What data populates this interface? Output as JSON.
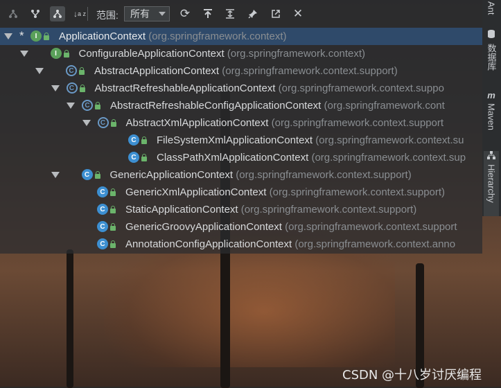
{
  "toolbar": {
    "scope_label": "范围:",
    "scope_value": "所有",
    "icons": [
      "supertype-hierarchy-icon",
      "subtype-hierarchy-icon",
      "class-hierarchy-icon",
      "sort-alpha-icon",
      "refresh-icon",
      "export-icon",
      "expand-all-icon",
      "pin-icon",
      "open-in-new-icon",
      "close-icon"
    ]
  },
  "tree": [
    {
      "name": "ApplicationContext",
      "pkg": "(org.springframework.context)",
      "kind": "interface",
      "star": "*",
      "selected": true
    },
    {
      "name": "ConfigurableApplicationContext",
      "pkg": "(org.springframework.context)",
      "kind": "interface"
    },
    {
      "name": "AbstractApplicationContext",
      "pkg": "(org.springframework.context.support)",
      "kind": "abstract"
    },
    {
      "name": "AbstractRefreshableApplicationContext",
      "pkg": "(org.springframework.context.suppo",
      "kind": "abstract"
    },
    {
      "name": "AbstractRefreshableConfigApplicationContext",
      "pkg": "(org.springframework.cont",
      "kind": "abstract"
    },
    {
      "name": "AbstractXmlApplicationContext",
      "pkg": "(org.springframework.context.support",
      "kind": "abstract"
    },
    {
      "name": "FileSystemXmlApplicationContext",
      "pkg": "(org.springframework.context.su",
      "kind": "class"
    },
    {
      "name": "ClassPathXmlApplicationContext",
      "pkg": "(org.springframework.context.sup",
      "kind": "class"
    },
    {
      "name": "GenericApplicationContext",
      "pkg": "(org.springframework.context.support)",
      "kind": "class"
    },
    {
      "name": "GenericXmlApplicationContext",
      "pkg": "(org.springframework.context.support)",
      "kind": "class"
    },
    {
      "name": "StaticApplicationContext",
      "pkg": "(org.springframework.context.support)",
      "kind": "class"
    },
    {
      "name": "GenericGroovyApplicationContext",
      "pkg": "(org.springframework.context.support",
      "kind": "class"
    },
    {
      "name": "AnnotationConfigApplicationContext",
      "pkg": "(org.springframework.context.anno",
      "kind": "class"
    }
  ],
  "side_tabs": [
    {
      "label": "Ant",
      "icon": ""
    },
    {
      "label": "数据库",
      "icon": "database-icon"
    },
    {
      "label": "Maven",
      "icon": "maven-icon"
    },
    {
      "label": "Hierarchy",
      "icon": "hierarchy-icon"
    }
  ],
  "watermark": "CSDN @十八岁讨厌编程",
  "colors": {
    "selected_row": "#2f4a6a",
    "interface_icon": "#5aa05a",
    "class_icon": "#3d8fd1",
    "package_text": "#8a8e92"
  }
}
